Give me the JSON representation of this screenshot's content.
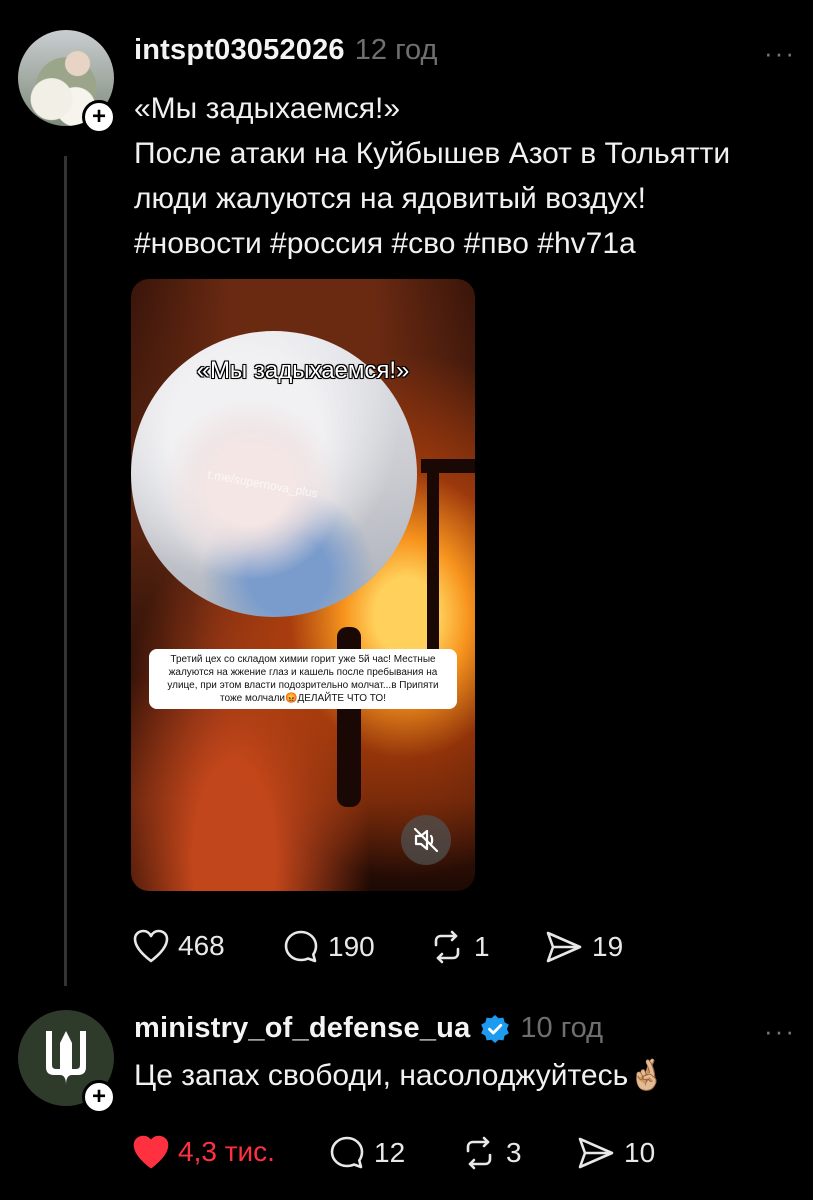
{
  "post": {
    "username": "intspt03052026",
    "time": "12 год",
    "more": "···",
    "text_lines": [
      "«Мы задыхаемся!»",
      "После атаки на Куйбышев Азот в Тольятти",
      "люди жалуются на ядовитый воздух!",
      "#новости #россия #сво #пво #hv71a"
    ],
    "video": {
      "title": "«Мы задыхаемся!»",
      "watermark": "t.me/supernova_plus",
      "caption": "Третий цех со складом химии горит уже 5й час! Местные жалуются на жжение глаз и кашель после пребывания на улице, при этом власти подозрительно молчат...в Припяти тоже молчали😡ДЕЛАЙТЕ ЧТО ТО!",
      "muted_icon": "speaker-muted-icon"
    },
    "actions": {
      "likes": "468",
      "comments": "190",
      "reposts": "1",
      "shares": "19"
    }
  },
  "reply": {
    "username": "ministry_of_defense_ua",
    "verified": true,
    "time": "10 год",
    "more": "···",
    "text": "Це запах свободи, насолоджуйтесь🤞🏼",
    "actions": {
      "likes": "4,3 тис.",
      "comments": "12",
      "reposts": "3",
      "shares": "10"
    }
  },
  "colors": {
    "background": "#000000",
    "like_active": "#ff3040",
    "verified": "#1d9bf0",
    "muted_text": "#6f6f6f"
  }
}
